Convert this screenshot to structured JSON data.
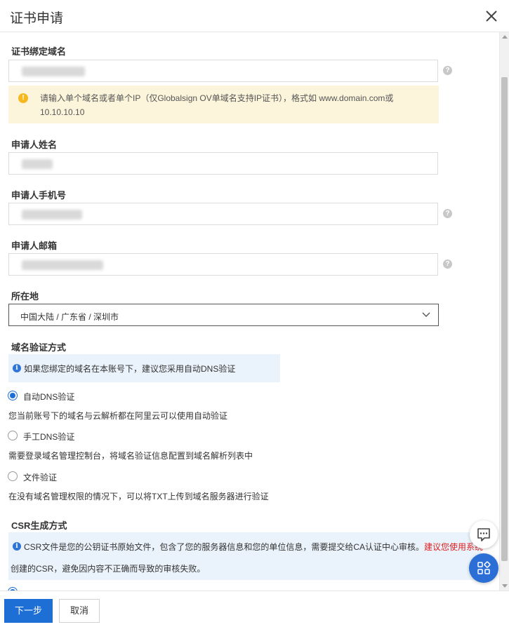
{
  "dialog": {
    "title": "证书申请"
  },
  "form": {
    "domain": {
      "label": "证书绑定域名"
    },
    "warning": {
      "text": "请输入单个域名或者单个IP（仅Globalsign OV单域名支持IP证书），格式如 www.domain.com或10.10.10.10"
    },
    "applicant_name": {
      "label": "申请人姓名"
    },
    "applicant_phone": {
      "label": "申请人手机号"
    },
    "applicant_email": {
      "label": "申请人邮箱"
    },
    "location": {
      "label": "所在地",
      "value": "中国大陆 / 广东省 / 深圳市"
    },
    "verify": {
      "label": "域名验证方式",
      "tip": "如果您绑定的域名在本账号下，建议您采用自动DNS验证",
      "options": [
        {
          "label": "自动DNS验证",
          "desc": "您当前账号下的域名与云解析都在阿里云可以使用自动验证",
          "selected": true
        },
        {
          "label": "手工DNS验证",
          "desc": "需要登录域名管理控制台，将域名验证信息配置到域名解析列表中",
          "selected": false
        },
        {
          "label": "文件验证",
          "desc": "在没有域名管理权限的情况下，可以将TXT上传到域名服务器进行验证",
          "selected": false
        }
      ]
    },
    "csr": {
      "label": "CSR生成方式",
      "tip_normal": "CSR文件是您的公钥证书原始文件，包含了您的服务器信息和您的单位信息，需要提交给CA认证中心审核。",
      "tip_red_1": "建议您使用系统",
      "tip_red_2": "创建的CSR，避免因内容不正确而导致的审核失败。"
    }
  },
  "footer": {
    "next_label": "下一步",
    "cancel_label": "取消"
  },
  "icons": {
    "close": "close-icon",
    "help": "question-icon",
    "warning": "exclamation-icon",
    "info": "info-icon",
    "chat": "chat-icon",
    "apps": "apps-grid-icon"
  },
  "colors": {
    "primary": "#1d6fd6",
    "warning_bg": "#fcf5dc",
    "info_bg": "#eaf3fb",
    "danger": "#e02020"
  }
}
